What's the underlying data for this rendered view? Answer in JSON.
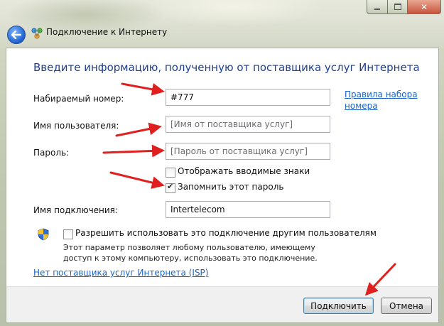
{
  "window": {
    "title": "Подключение к Интернету"
  },
  "form": {
    "heading": "Введите информацию, полученную от поставщика услуг Интернета",
    "dial_number_label": "Набираемый номер:",
    "dial_number_value": "#777",
    "dialing_rules_link": "Правила набора номера",
    "dialing_rules_line1": "Правила набора",
    "dialing_rules_line2": "номера",
    "username_label": "Имя пользователя:",
    "username_placeholder": "[Имя от поставщика услуг]",
    "password_label": "Пароль:",
    "password_placeholder": "[Пароль от поставщика услуг]",
    "show_chars_label": "Отображать вводимые знаки",
    "show_chars_checked": false,
    "remember_password_label": "Запомнить этот пароль",
    "remember_password_checked": true,
    "connection_name_label": "Имя подключения:",
    "connection_name_value": "Intertelecom",
    "share_label": "Разрешить использовать это подключение другим пользователям",
    "share_checked": false,
    "share_description": "Этот параметр позволяет любому пользователю, имеющему доступ к этому компьютеру, использовать это подключение.",
    "no_isp_link": "Нет поставщика услуг Интернета (ISP)"
  },
  "buttons": {
    "connect": "Подключить",
    "cancel": "Отмена"
  },
  "colors": {
    "heading": "#1e3f8f",
    "link": "#1a64c8",
    "annotation_arrow": "#e0201e"
  },
  "icons": {
    "back": "back-arrow-icon",
    "network": "network-icon",
    "shield": "uac-shield-icon",
    "minimize": "minimize-icon",
    "maximize": "maximize-icon",
    "close": "close-icon"
  }
}
